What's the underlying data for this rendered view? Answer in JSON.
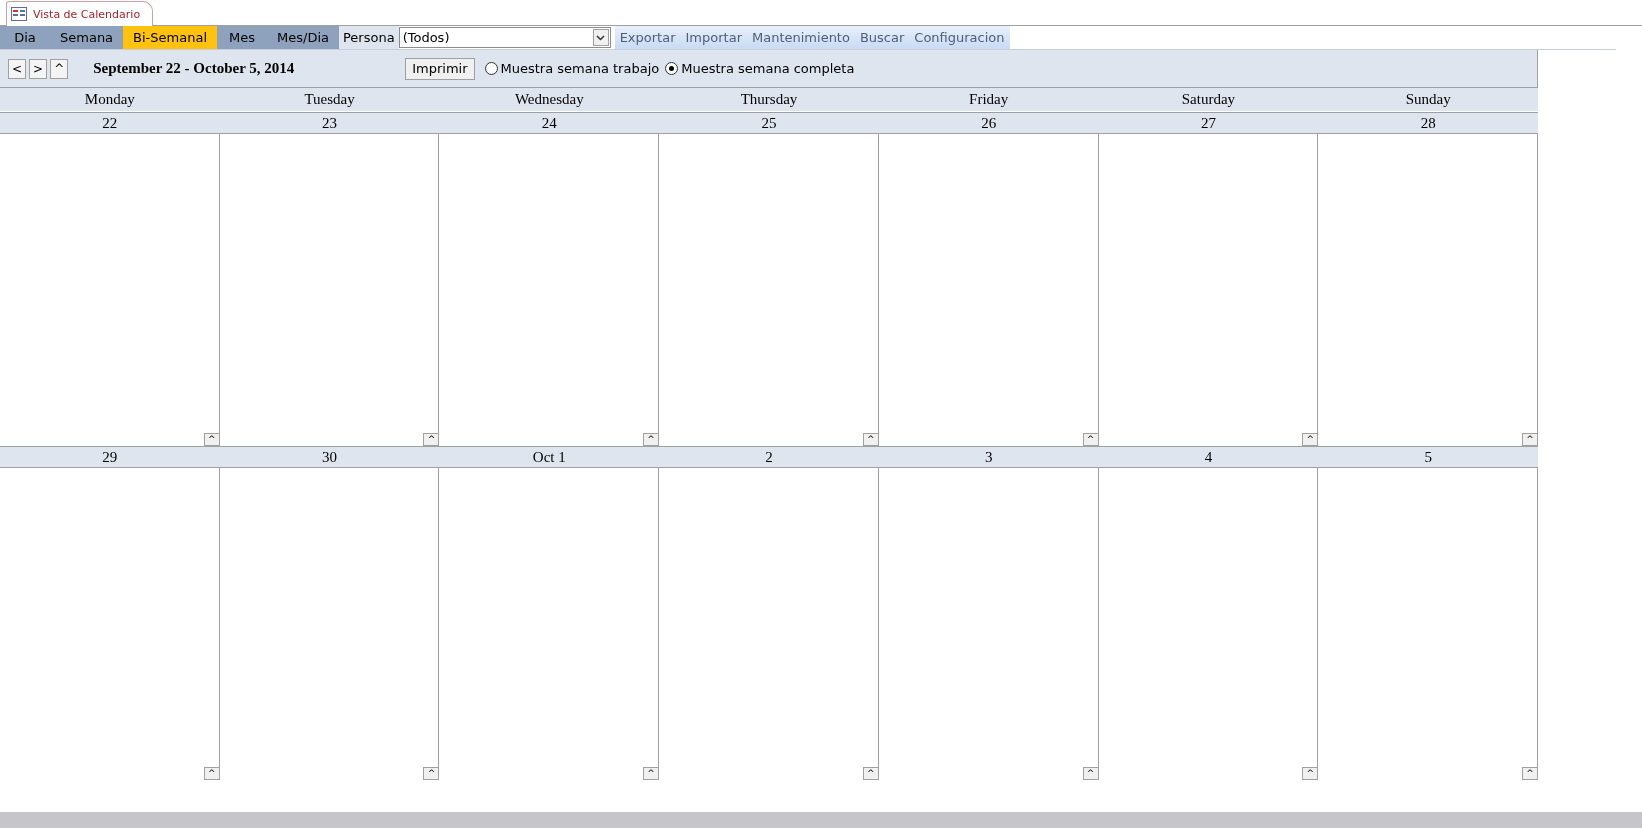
{
  "document_tab": {
    "title": "Vista de Calendario"
  },
  "view_tabs": [
    {
      "label": "Dia",
      "selected": false
    },
    {
      "label": "Semana",
      "selected": false
    },
    {
      "label": "Bi-Semanal",
      "selected": true
    },
    {
      "label": "Mes",
      "selected": false
    },
    {
      "label": "Mes/Dia",
      "selected": false
    }
  ],
  "persona": {
    "label": "Persona",
    "value": "(Todos)"
  },
  "actions": [
    "Exportar",
    "Importar",
    "Mantenimiento",
    "Buscar",
    "Configuracion"
  ],
  "nav_buttons": [
    "<",
    ">",
    "^"
  ],
  "range_title": "September 22 - October 5, 2014",
  "print_button": "Imprimir",
  "week_options": [
    {
      "label": "Muestra semana trabajo",
      "selected": false
    },
    {
      "label": "Muestra semana completa",
      "selected": true
    }
  ],
  "weekdays": [
    "Monday",
    "Tuesday",
    "Wednesday",
    "Thursday",
    "Friday",
    "Saturday",
    "Sunday"
  ],
  "weeks": [
    {
      "days": [
        {
          "date": "22",
          "more": "^"
        },
        {
          "date": "23",
          "more": "^"
        },
        {
          "date": "24",
          "more": "^"
        },
        {
          "date": "25",
          "more": "^"
        },
        {
          "date": "26",
          "more": "^"
        },
        {
          "date": "27",
          "more": "^"
        },
        {
          "date": "28",
          "more": "^"
        }
      ]
    },
    {
      "days": [
        {
          "date": "29",
          "more": "^"
        },
        {
          "date": "30",
          "more": "^"
        },
        {
          "date": "Oct 1",
          "more": "^"
        },
        {
          "date": "2",
          "more": "^"
        },
        {
          "date": "3",
          "more": "^"
        },
        {
          "date": "4",
          "more": "^"
        },
        {
          "date": "5",
          "more": "^"
        }
      ]
    }
  ]
}
